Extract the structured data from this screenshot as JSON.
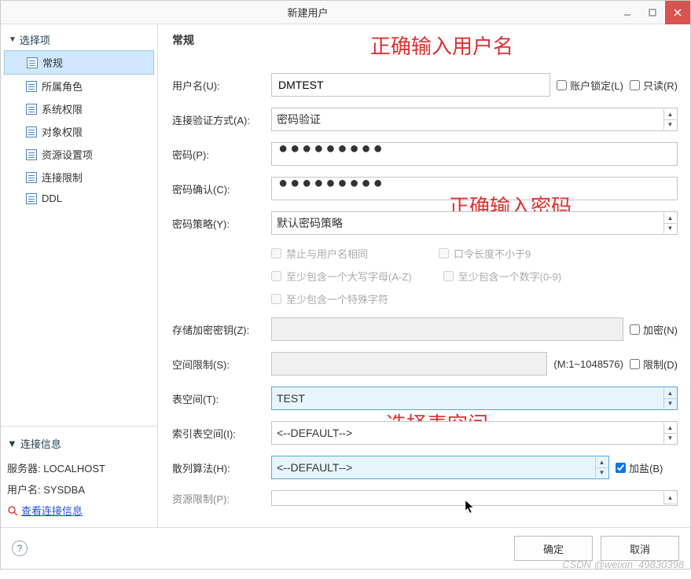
{
  "window": {
    "title": "新建用户"
  },
  "sidebar": {
    "selection_header": "选择项",
    "items": [
      {
        "label": "常规"
      },
      {
        "label": "所属角色"
      },
      {
        "label": "系统权限"
      },
      {
        "label": "对象权限"
      },
      {
        "label": "资源设置项"
      },
      {
        "label": "连接限制"
      },
      {
        "label": "DDL"
      }
    ],
    "conn_header": "连接信息",
    "server_label": "服务器:",
    "server_value": "LOCALHOST",
    "user_label": "用户名:",
    "user_value": "SYSDBA",
    "view_link": "查看连接信息"
  },
  "form": {
    "section_title": "常规",
    "username_label": "用户名(U):",
    "username_value": "DMTEST",
    "lock_label": "账户锁定(L)",
    "readonly_label": "只读(R)",
    "auth_label": "连接验证方式(A):",
    "auth_value": "密码验证",
    "pwd_label": "密码(P):",
    "pwd_value": "●●●●●●●●●",
    "pwd2_label": "密码确认(C):",
    "pwd2_value": "●●●●●●●●●",
    "policy_label": "密码策略(Y):",
    "policy_value": "默认密码策略",
    "policy_opts": {
      "o1": "禁止与用户名相同",
      "o2": "口令长度不小于9",
      "o3": "至少包含一个大写字母(A-Z)",
      "o4": "至少包含一个数字(0-9)",
      "o5": "至少包含一个特殊字符"
    },
    "storekey_label": "存储加密密钥(Z):",
    "encrypt_label": "加密(N)",
    "space_label": "空间限制(S):",
    "space_range": "(M:1~1048576)",
    "limit_label": "限制(D)",
    "tablespace_label": "表空间(T):",
    "tablespace_value": "TEST",
    "indexspace_label": "索引表空间(I):",
    "indexspace_value": "<--DEFAULT-->",
    "hash_label": "散列算法(H):",
    "hash_value": "<--DEFAULT-->",
    "salt_label": "加盐(B)",
    "reslimit_label": "资源限制(P):"
  },
  "annotations": {
    "a1": "正确输入用户名",
    "a2": "正确输入密码",
    "a3": "选择表空间"
  },
  "footer": {
    "ok": "确定",
    "cancel": "取消"
  },
  "watermark": "CSDN @weixin_49830398"
}
